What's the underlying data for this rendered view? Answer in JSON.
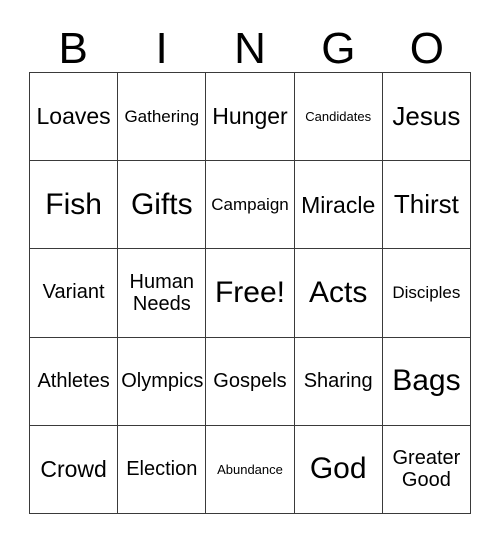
{
  "card": {
    "title": "BINGO",
    "header_letters": [
      "B",
      "I",
      "N",
      "G",
      "O"
    ],
    "free_space_label": "Free!",
    "rows": [
      [
        {
          "label": "Loaves",
          "size": "lg"
        },
        {
          "label": "Gathering",
          "size": "sm"
        },
        {
          "label": "Hunger",
          "size": "lg"
        },
        {
          "label": "Candidates",
          "size": "xs"
        },
        {
          "label": "Jesus",
          "size": "xl"
        }
      ],
      [
        {
          "label": "Fish",
          "size": "xxl"
        },
        {
          "label": "Gifts",
          "size": "xxl"
        },
        {
          "label": "Campaign",
          "size": "sm"
        },
        {
          "label": "Miracle",
          "size": "lg"
        },
        {
          "label": "Thirst",
          "size": "xl"
        }
      ],
      [
        {
          "label": "Variant",
          "size": "md"
        },
        {
          "label": "Human\nNeeds",
          "size": "md",
          "lines": 2
        },
        {
          "label": "Free!",
          "size": "xxl"
        },
        {
          "label": "Acts",
          "size": "xxl"
        },
        {
          "label": "Disciples",
          "size": "sm"
        }
      ],
      [
        {
          "label": "Athletes",
          "size": "md"
        },
        {
          "label": "Olympics",
          "size": "md"
        },
        {
          "label": "Gospels",
          "size": "md"
        },
        {
          "label": "Sharing",
          "size": "md"
        },
        {
          "label": "Bags",
          "size": "xxl"
        }
      ],
      [
        {
          "label": "Crowd",
          "size": "lg"
        },
        {
          "label": "Election",
          "size": "md"
        },
        {
          "label": "Abundance",
          "size": "xs"
        },
        {
          "label": "God",
          "size": "xxl"
        },
        {
          "label": "Greater\nGood",
          "size": "md",
          "lines": 2
        }
      ]
    ]
  },
  "colors": {
    "background": "#ffffff",
    "text": "#000000",
    "grid_line": "#3a3a3a"
  }
}
